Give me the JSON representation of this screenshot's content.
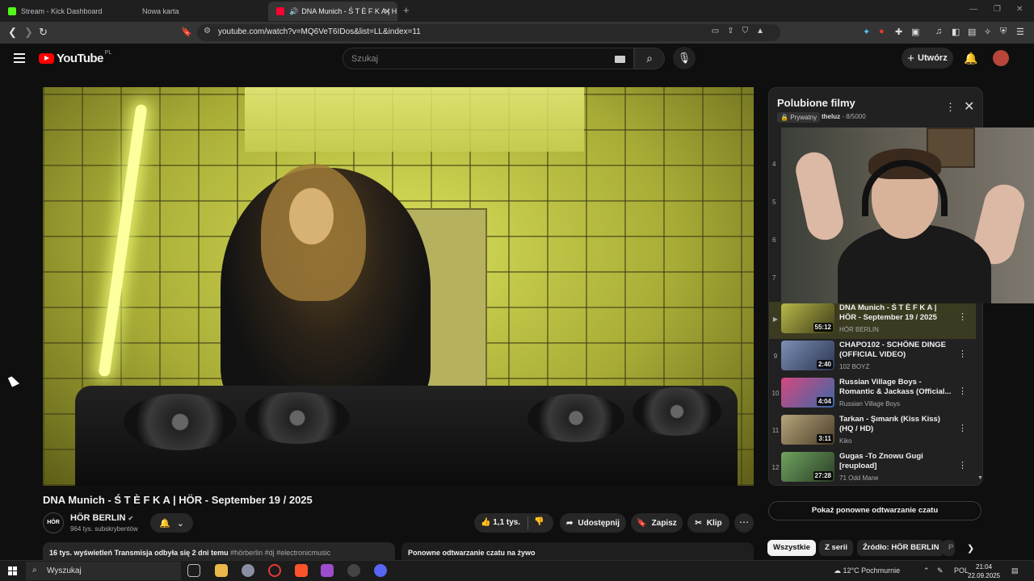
{
  "browser": {
    "tabs": [
      {
        "label": "Stream - Kick Dashboard",
        "active": false
      },
      {
        "label": "Nowa karta",
        "active": false
      },
      {
        "label": "DNA Munich - Ś T È F K A | H",
        "active": true
      }
    ],
    "url": "youtube.com/watch?v=MQ6VeT6IDos&list=LL&index=11"
  },
  "header": {
    "logo_text": "YouTube",
    "country_code": "PL",
    "search_placeholder": "Szukaj",
    "create_label": "Utwórz"
  },
  "video": {
    "title": "DNA Munich - Ś T È F K A | HÖR - September 19 / 2025",
    "channel_avatar_text": "HÖR",
    "channel_name": "HÖR BERLIN",
    "subscribers": "964 tys. subskrybentów",
    "likes": "1,1 tys.",
    "share_label": "Udostępnij",
    "save_label": "Zapisz",
    "clip_label": "Klip",
    "description_stats": "16 tys. wyświetleń  Transmisja odbyła się 2 dni temu",
    "description_tags": "#hörberlin #dj #electronicmusic",
    "chat_replay_label": "Ponowne odtwarzanie czatu na żywo"
  },
  "playlist": {
    "title": "Polubione filmy",
    "privacy": "Prywatny",
    "owner": "theluz",
    "position": "8/5000",
    "hidden_indices": [
      "4",
      "5",
      "6",
      "7"
    ],
    "items": [
      {
        "index": "",
        "title": "DNA Munich - Ś T È F K A | HÖR - September 19 / 2025",
        "channel": "HÖR BERLIN",
        "duration": "55:12",
        "current": true,
        "thumb_color": "#7a7a2c"
      },
      {
        "index": "9",
        "title": "CHAPO102 - SCHÖNE DINGE (OFFICIAL VIDEO)",
        "channel": "102 BOYZ",
        "duration": "2:40",
        "current": false,
        "thumb_color": "#5b6c8f"
      },
      {
        "index": "10",
        "title": "Russian Village Boys - Romantic & Jackass (Official...",
        "channel": "Russian Village Boys",
        "duration": "4:04",
        "current": false,
        "thumb_color": "#a33a6e"
      },
      {
        "index": "11",
        "title": "Tarkan - Şımarık (Kiss Kiss) (HQ / HD)",
        "channel": "Kiko",
        "duration": "3:11",
        "current": false,
        "thumb_color": "#8a7a52"
      },
      {
        "index": "12",
        "title": "Gugas -To Znowu Gugi [reupload]",
        "channel": "71 Odd Mane",
        "duration": "27:28",
        "current": false,
        "thumb_color": "#4d7a45"
      }
    ]
  },
  "sidebar": {
    "show_chat_label": "Pokaż ponowne odtwarzanie czatu",
    "chips": [
      {
        "label": "Wszystkie",
        "active": true
      },
      {
        "label": "Z serii",
        "active": false
      },
      {
        "label": "Źródło: HÖR BERLIN",
        "active": false
      },
      {
        "label": "P",
        "active": false
      }
    ]
  },
  "taskbar": {
    "search_label": "Wyszukaj",
    "weather": "12°C  Pochmurnie",
    "language": "POL",
    "time": "21:04",
    "date": "22.09.2025"
  }
}
